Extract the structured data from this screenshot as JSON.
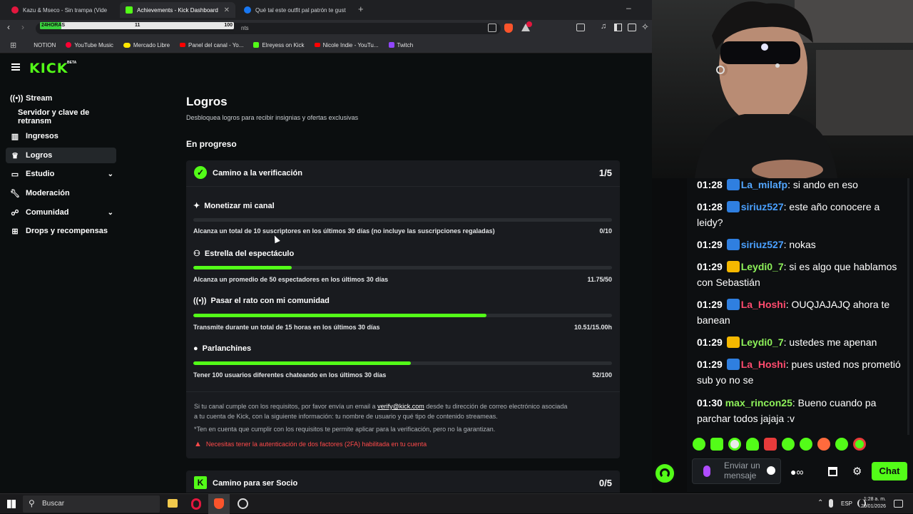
{
  "browser": {
    "tabs": [
      {
        "title": "Kazu & Mseco - Sin trampa (Vide",
        "active": false
      },
      {
        "title": "Achievements - Kick Dashboard",
        "active": true
      },
      {
        "title": "Qué tal este outfit pal patrón te gust",
        "active": false
      }
    ],
    "new_tab": "+",
    "minimize": "–",
    "progress": {
      "label": "24HORAS",
      "current": "11",
      "max": "100",
      "fraction": 0.11
    },
    "url_fragment": "nts",
    "bookmarks": [
      "NOTION",
      "YouTube Music",
      "Mercado Libre",
      "Panel del canal - Yo...",
      "Elreyess on Kick",
      "Nicole Indie - YouTu...",
      "Twitch"
    ]
  },
  "kick": {
    "logo": "KICK",
    "logo_tag": "BETA",
    "sidebar": [
      {
        "label": "Stream",
        "icon": "stream-icon"
      },
      {
        "label": "Servidor y clave de retransm",
        "icon": ""
      },
      {
        "label": "Ingresos",
        "icon": "chart-icon"
      },
      {
        "label": "Logros",
        "icon": "trophy-icon",
        "active": true
      },
      {
        "label": "Estudio",
        "icon": "studio-icon",
        "expandable": true
      },
      {
        "label": "Moderación",
        "icon": "wrench-icon"
      },
      {
        "label": "Comunidad",
        "icon": "community-icon",
        "expandable": true
      },
      {
        "label": "Drops y recompensas",
        "icon": "drops-icon"
      }
    ],
    "page_title": "Logros",
    "page_subtitle": "Desbloquea logros para recibir insignias y ofertas exclusivas",
    "section": "En progreso",
    "card1": {
      "title": "Camino a la verificación",
      "score": "1/5",
      "achievements": [
        {
          "name": "Monetizar mi canal",
          "desc": "Alcanza un total de 10 suscriptores en los últimos 30 días (no incluye las suscripciones regaladas)",
          "value": "0/10",
          "progress": 0.0
        },
        {
          "name": "Estrella del espectáculo",
          "desc": "Alcanza un promedio de 50 espectadores en los últimos 30 días",
          "value": "11.75/50",
          "progress": 0.235
        },
        {
          "name": "Pasar el rato con mi comunidad",
          "desc": "Transmite durante un total de 15 horas en los últimos 30 días",
          "value": "10.51/15.00h",
          "progress": 0.7007
        },
        {
          "name": "Parlanchines",
          "desc": "Tener 100 usuarios diferentes chateando en los últimos 30 días",
          "value": "52/100",
          "progress": 0.52
        }
      ],
      "note_pre": "Si tu canal cumple con los requisitos, por favor envía un email a ",
      "note_email": "verify@kick.com",
      "note_post": " desde tu dirección de correo electrónico asociada",
      "note_line2": "a tu cuenta de Kick, con la siguiente información: tu nombre de usuario y qué tipo de contenido streameas.",
      "disclaimer": "*Ten en cuenta que cumplir con los requisitos te permite aplicar para la verificación, pero no la garantizan.",
      "warning": "Necesitas tener la autenticación de dos factores (2FA) habilitada en tu cuenta"
    },
    "card2": {
      "title": "Camino para ser Socio",
      "score": "0/5"
    }
  },
  "chat": {
    "messages": [
      {
        "time": "01:28",
        "user": "La_milafp",
        "color": "#53a7ff",
        "text": ": si ando en eso",
        "badge": "mod"
      },
      {
        "time": "01:28",
        "user": "siriuz527",
        "color": "#4aa0ff",
        "text": ": este año conocere a leidy?",
        "badge": "mod"
      },
      {
        "time": "01:29",
        "user": "siriuz527",
        "color": "#4aa0ff",
        "text": ": nokas",
        "badge": "mod"
      },
      {
        "time": "01:29",
        "user": "Leydi0_7",
        "color": "#8ef25a",
        "text": ": si es algo que hablamos con Sebastián",
        "badge": "crown"
      },
      {
        "time": "01:29",
        "user": "La_Hoshi",
        "color": "#ff4b6e",
        "text": ": OUQJAJAJQ ahora te banean",
        "badge": "mod"
      },
      {
        "time": "01:29",
        "user": "Leydi0_7",
        "color": "#8ef25a",
        "text": ": ustedes me apenan",
        "badge": "crown"
      },
      {
        "time": "01:29",
        "user": "La_Hoshi",
        "color": "#ff4b6e",
        "text": ": pues usted nos prometió sub yo no se",
        "badge": "mod"
      },
      {
        "time": "01:30",
        "user": "max_rincon25",
        "color": "#8ef25a",
        "text": ": Bueno cuando pa parchar todos jajaja :v",
        "badge": ""
      }
    ],
    "input_placeholder": "Enviar un mensaje",
    "send_label": "Chat"
  },
  "taskbar": {
    "search": "Buscar",
    "lang": "ESP",
    "time": "1:28 a. m.",
    "date": "20/01/2026"
  },
  "colors": {
    "kick_green": "#53fc18",
    "warning_red": "#ff4a4a"
  }
}
